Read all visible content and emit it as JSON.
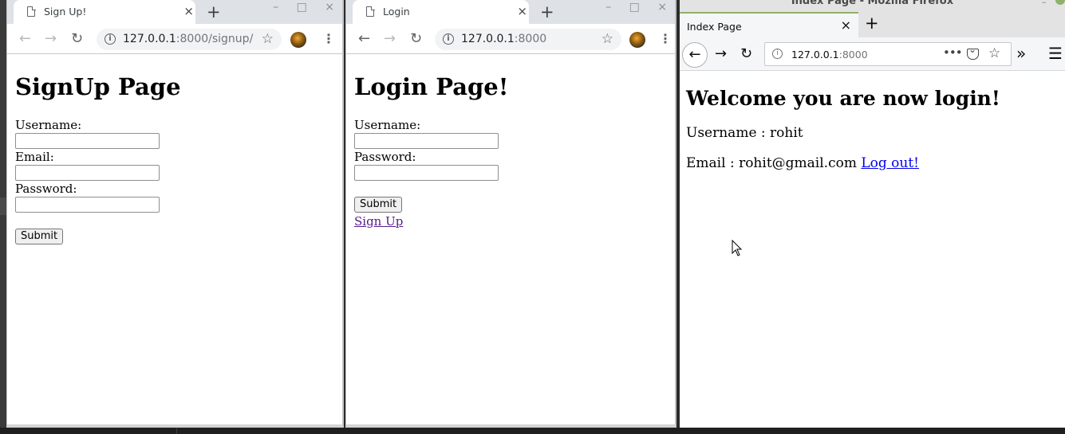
{
  "signup_window": {
    "tab_title": "Sign Up!",
    "url_host": "127.0.0.1",
    "url_rest": ":8000/signup/",
    "heading": "SignUp Page",
    "username_label": "Username:",
    "username_value": "",
    "email_label": "Email:",
    "email_value": "",
    "password_label": "Password:",
    "password_value": "",
    "submit_label": "Submit"
  },
  "login_window": {
    "tab_title": "Login",
    "url_host": "127.0.0.1",
    "url_rest": ":8000",
    "heading": "Login Page!",
    "username_label": "Username:",
    "username_value": "",
    "password_label": "Password:",
    "password_value": "",
    "submit_label": "Submit",
    "signup_link": "Sign Up"
  },
  "firefox_window": {
    "window_title": "Index Page - Mozilla Firefox",
    "tab_title": "Index Page",
    "url_host": "127.0.0.1",
    "url_rest": ":8000",
    "heading": "Welcome you are now login!",
    "username_line": "Username : rohit",
    "email_line": "Email : rohit@gmail.com",
    "logout_link": "Log out!"
  },
  "icons": {
    "chrome_page": "page-icon",
    "chrome_close": "×",
    "new_tab": "+",
    "back": "←",
    "forward": "→",
    "reload": "↻",
    "info": "i",
    "star": "☆",
    "kebab": "⋮",
    "minimize": "–",
    "maximize": "□",
    "window_close": "×",
    "overflow": "»",
    "menu": "☰",
    "more": "•••"
  },
  "colors": {
    "chrome_frame": "#dee1e6",
    "firefox_accent": "#8fb06a",
    "visited_link": "#551a8b",
    "link": "#0000ee"
  }
}
